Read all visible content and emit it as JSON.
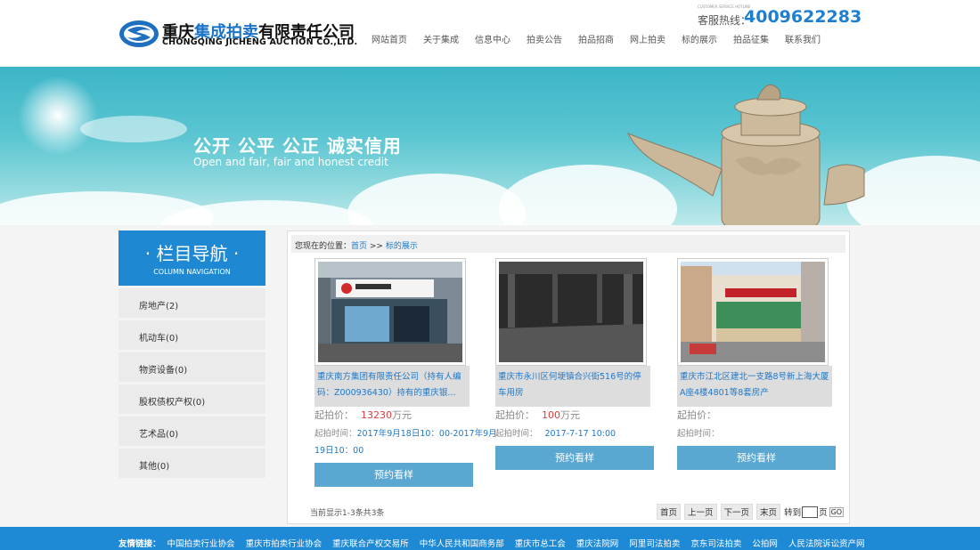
{
  "brand": {
    "name_prefix": "重庆",
    "name_highlight": "集成拍卖",
    "name_suffix": "有限责任公司",
    "name_en": "CHONGQING JICHENG AUCTION CO.,LTD."
  },
  "hotline": {
    "small": "CUSTOMER SERVICE HOTLINE",
    "label": "客服热线：",
    "number": "4009622283"
  },
  "nav": [
    "网站首页",
    "关于集成",
    "信息中心",
    "拍卖公告",
    "拍品招商",
    "网上拍卖",
    "标的展示",
    "拍品征集",
    "联系我们"
  ],
  "banner": {
    "title": "公开  公平  公正  诚实信用",
    "subtitle": "Open and fair, fair and honest credit"
  },
  "sidebar": {
    "title": "· 栏目导航 ·",
    "subtitle": "COLUMN NAVIGATION",
    "items": [
      "房地产(2)",
      "机动车(0)",
      "物资设备(0)",
      "股权债权产权(0)",
      "艺术品(0)",
      "其他(0)"
    ]
  },
  "breadcrumb": {
    "prefix": "您现在的位置：",
    "home": "首页",
    "sep": " >> ",
    "current": "标的展示"
  },
  "items": [
    {
      "title": "重庆南方集团有限责任公司（持有人编码：Z000936430）持有的重庆银...",
      "price_label": "起拍价：",
      "price": "13230",
      "unit": "万元",
      "time_label": "起拍时间：",
      "time": "2017年9月18日10：00-2017年9月19日10：00",
      "button": "预约看样"
    },
    {
      "title": "重庆市永川区何埂镇合兴街516号的停车用房",
      "price_label": "起拍价：",
      "price": "100",
      "unit": "万元",
      "time_label": "起拍时间：",
      "time": "2017-7-17 10:00",
      "button": "预约看样"
    },
    {
      "title": "重庆市江北区建北一支路8号新上海大厦A座4楼4801等8套房产",
      "price_label": "起拍价：",
      "price": "",
      "unit": "",
      "time_label": "起拍时间：",
      "time": "",
      "button": "预约看样"
    }
  ],
  "summary": "当前显示1-3条共3条",
  "pager": {
    "first": "首页",
    "prev": "上一页",
    "next": "下一页",
    "last": "末页",
    "goto_label": "转到",
    "page_suffix": "页",
    "go": "GO"
  },
  "footer": {
    "label": "友情链接：",
    "links": [
      "中国拍卖行业协会",
      "重庆市拍卖行业协会",
      "重庆联合产权交易所",
      "中华人民共和国商务部",
      "重庆市总工会",
      "重庆法院网",
      "阿里司法拍卖",
      "京东司法拍卖",
      "公拍网",
      "人民法院诉讼资产网"
    ]
  },
  "colors": {
    "primary": "#1e88d2",
    "button": "#5aa7d2",
    "price": "#e03a3a",
    "link": "#1e78c8"
  }
}
